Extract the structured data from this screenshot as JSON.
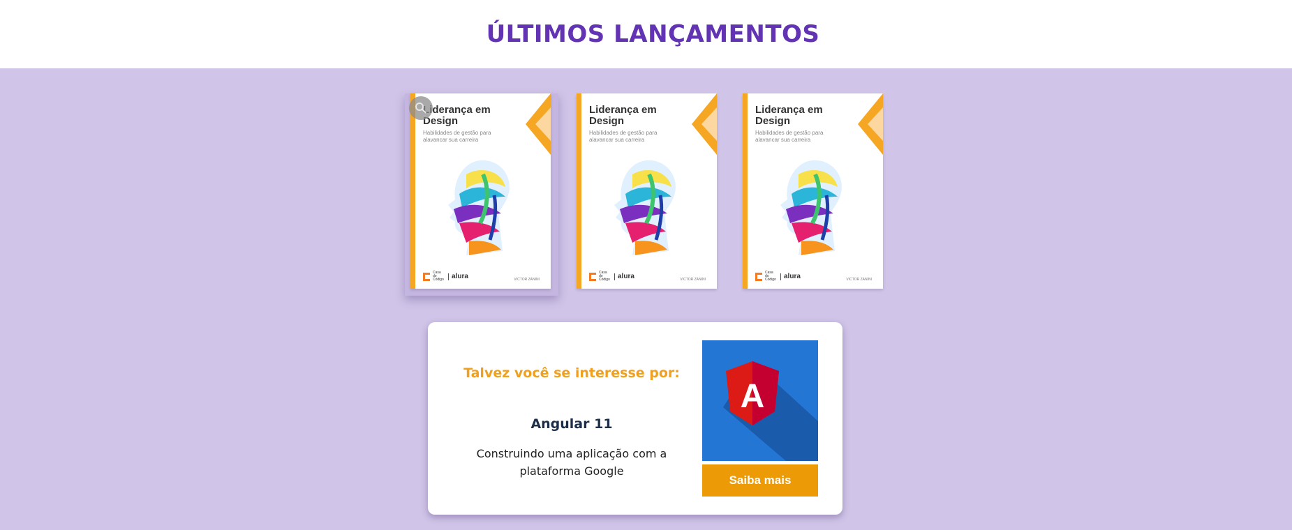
{
  "header": {
    "title": "ÚLTIMOS LANÇAMENTOS"
  },
  "books": [
    {
      "title": "Liderança em Design",
      "subtitle": "Habilidades de gestão para alavancar sua carreira",
      "publisher": "Casa do Código",
      "partner": "alura",
      "author": "VICTOR ZANINI"
    },
    {
      "title": "Liderança em Design",
      "subtitle": "Habilidades de gestão para alavancar sua carreira",
      "publisher": "Casa do Código",
      "partner": "alura",
      "author": "VICTOR ZANINI"
    },
    {
      "title": "Liderança em Design",
      "subtitle": "Habilidades de gestão para alavancar sua carreira",
      "publisher": "Casa do Código",
      "partner": "alura",
      "author": "VICTOR ZANINI"
    }
  ],
  "suggestion": {
    "lead": "Talvez você se interesse por:",
    "course_title": "Angular 11",
    "course_description": "Construindo uma aplicação com a plataforma Google",
    "thumbnail_letter": "A",
    "cta_label": "Saiba mais"
  },
  "colors": {
    "heading": "#6233b2",
    "background": "#d0c4e8",
    "accent_orange": "#ec9a06",
    "angular_red": "#dd1b16",
    "thumb_blue": "#2476d4"
  },
  "icons": [
    "search-icon",
    "angular-logo-icon",
    "casa-do-codigo-logo-icon"
  ]
}
